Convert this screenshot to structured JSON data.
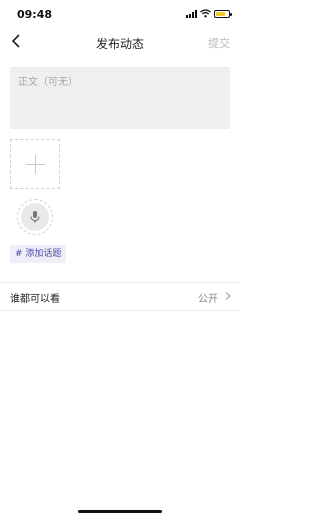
{
  "status_bar": {
    "time": "09:48"
  },
  "nav": {
    "title": "发布动态",
    "submit_label": "提交"
  },
  "editor": {
    "placeholder": "正文（可无）"
  },
  "topic": {
    "label": "# 添加话题"
  },
  "privacy": {
    "label": "谁都可以看",
    "value": "公开"
  },
  "colors": {
    "topic_text": "#4a4aa6",
    "battery": "#f4c531"
  }
}
